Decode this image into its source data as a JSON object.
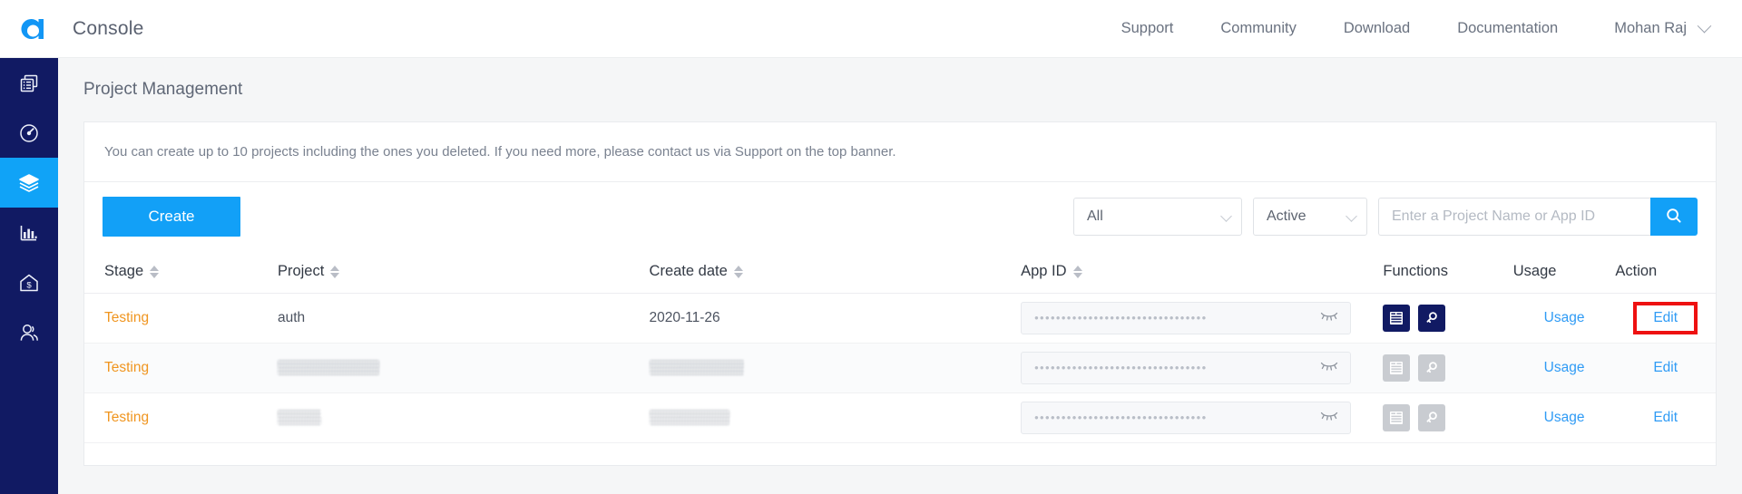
{
  "topbar": {
    "logo_icon": "agora-logo-icon",
    "title": "Console",
    "nav": [
      {
        "label": "Support"
      },
      {
        "label": "Community"
      },
      {
        "label": "Download"
      },
      {
        "label": "Documentation"
      }
    ],
    "user": {
      "name": "Mohan Raj",
      "caret_icon": "chevron-down-icon"
    }
  },
  "sidebar": {
    "items": [
      {
        "name": "projects",
        "icon": "documents-icon",
        "active": false
      },
      {
        "name": "dashboard",
        "icon": "gauge-icon",
        "active": false
      },
      {
        "name": "project-management",
        "icon": "layers-icon",
        "active": true
      },
      {
        "name": "analytics",
        "icon": "bar-chart-icon",
        "active": false
      },
      {
        "name": "finance",
        "icon": "house-dollar-icon",
        "active": false
      },
      {
        "name": "members",
        "icon": "user-icon",
        "active": false
      }
    ]
  },
  "page": {
    "title": "Project Management",
    "notice": "You can create up to 10 projects including the ones you deleted. If you need more, please contact us via Support on the top banner."
  },
  "toolbar": {
    "create_label": "Create",
    "filter_type": {
      "value": "All",
      "caret_icon": "chevron-down-icon"
    },
    "filter_status": {
      "value": "Active",
      "caret_icon": "chevron-down-icon"
    },
    "search": {
      "value": "",
      "placeholder": "Enter a Project Name or App ID",
      "button_icon": "search-icon"
    }
  },
  "table": {
    "columns": [
      {
        "label": "Stage",
        "sortable": true
      },
      {
        "label": "Project",
        "sortable": true
      },
      {
        "label": "Create date",
        "sortable": true
      },
      {
        "label": "App ID",
        "sortable": true
      },
      {
        "label": "Functions",
        "sortable": false
      },
      {
        "label": "Usage",
        "sortable": false
      },
      {
        "label": "Action",
        "sortable": false
      }
    ],
    "rows": [
      {
        "stage": "Testing",
        "project": "auth",
        "create_date": "2020-11-26",
        "app_id_masked": "••••••••••••••••••••••••••••••••",
        "app_id_toggle_icon": "eye-closed-icon",
        "functions_enabled": true,
        "function_icons": [
          "config-list-icon",
          "key-icon"
        ],
        "usage_label": "Usage",
        "action_label": "Edit",
        "action_highlighted": true,
        "redacted": false
      },
      {
        "stage": "Testing",
        "project": "",
        "create_date": "",
        "app_id_masked": "••••••••••••••••••••••••••••••••",
        "app_id_toggle_icon": "eye-closed-icon",
        "functions_enabled": false,
        "function_icons": [
          "config-list-icon",
          "key-icon"
        ],
        "usage_label": "Usage",
        "action_label": "Edit",
        "action_highlighted": false,
        "redacted": true
      },
      {
        "stage": "Testing",
        "project": "",
        "create_date": "",
        "app_id_masked": "••••••••••••••••••••••••••••••••",
        "app_id_toggle_icon": "eye-closed-icon",
        "functions_enabled": false,
        "function_icons": [
          "config-list-icon",
          "key-icon"
        ],
        "usage_label": "Usage",
        "action_label": "Edit",
        "action_highlighted": false,
        "redacted": true
      }
    ]
  },
  "colors": {
    "accent_blue": "#12a0f7",
    "sidebar_navy": "#111a63",
    "stage_orange": "#f0951f",
    "link_blue": "#2f9bf5",
    "highlight_red": "#ee1111"
  }
}
